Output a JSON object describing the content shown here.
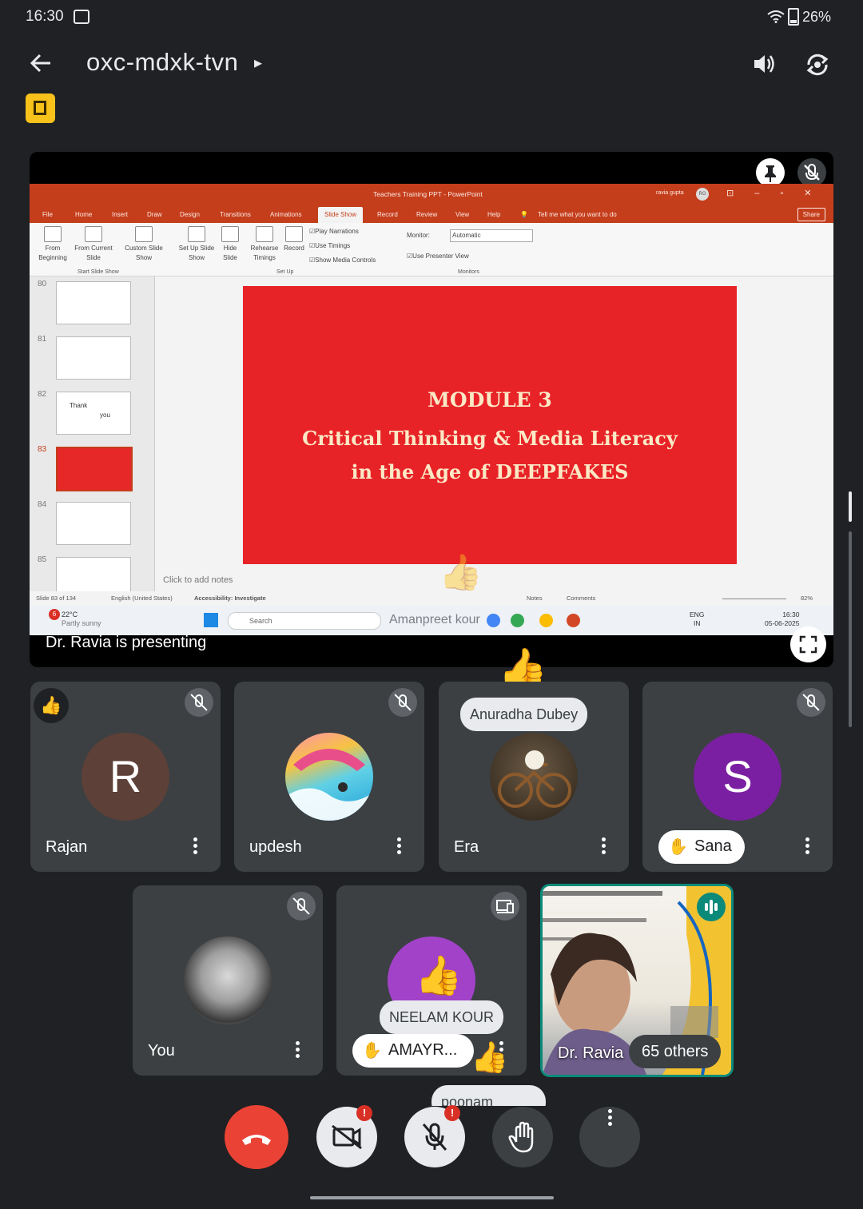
{
  "status_bar": {
    "time": "16:30",
    "battery": "26%"
  },
  "header": {
    "meeting_code": "oxc-mdxk-tvn"
  },
  "presentation": {
    "presenter_label": "Dr. Ravia is presenting",
    "overlay_name": "Amanpreet kour",
    "powerpoint": {
      "window_title": "Teachers Training PPT  -  PowerPoint",
      "user": "ravia gupta",
      "user_initials": "RG",
      "menus": [
        "File",
        "Home",
        "Insert",
        "Draw",
        "Design",
        "Transitions",
        "Animations",
        "Slide Show",
        "Record",
        "Review",
        "View",
        "Help"
      ],
      "active_menu": "Slide Show",
      "tell_me": "Tell me what you want to do",
      "share": "Share",
      "ribbon": {
        "from_beginning": "From Beginning",
        "from_current": "From Current Slide",
        "custom_show": "Custom Slide Show",
        "group_start": "Start Slide Show",
        "setup_show": "Set Up Slide Show",
        "hide_slide": "Hide Slide",
        "rehearse": "Rehearse Timings",
        "record": "Record",
        "group_setup": "Set Up",
        "play_narrations": "Play Narrations",
        "use_timings": "Use Timings",
        "show_media": "Show Media Controls",
        "monitor_label": "Monitor:",
        "monitor_value": "Automatic",
        "presenter_view": "Use Presenter View",
        "group_monitors": "Monitors"
      },
      "slide_numbers": [
        "80",
        "81",
        "82",
        "83",
        "84",
        "85"
      ],
      "thumb82_text1": "Thank",
      "thumb82_text2": "you",
      "slide": {
        "line1": "MODULE 3",
        "line2": "Critical Thinking & Media Literacy",
        "line3": "in the Age of DEEPFAKES"
      },
      "notes_placeholder": "Click to add notes",
      "status": {
        "slide_count": "Slide 83 of 134",
        "language": "English (United States)",
        "accessibility": "Accessibility: Investigate",
        "notes": "Notes",
        "comments": "Comments",
        "zoom": "82%"
      },
      "taskbar": {
        "temperature": "22°C",
        "weather": "Partly sunny",
        "weather_badge": "6",
        "search": "Search",
        "lang1": "ENG",
        "lang2": "IN",
        "time": "16:30",
        "date": "05-06-2025"
      }
    }
  },
  "participants": [
    {
      "name": "Rajan",
      "initial": "R",
      "color": "#5d4037",
      "muted": true,
      "reaction": "👍"
    },
    {
      "name": "updesh",
      "muted": true
    },
    {
      "name": "Era",
      "chip": "Anuradha Dubey",
      "reaction": "👍"
    },
    {
      "name": "Sana",
      "initial": "S",
      "color": "#7b1fa2",
      "muted": true,
      "hand_raised": true
    },
    {
      "name": "You",
      "muted": true
    },
    {
      "name": "AMAYR...",
      "chip": "NEELAM KOUR",
      "hand_raised": true,
      "reaction": "👍"
    },
    {
      "name": "Dr. Ravia",
      "others": "65 others",
      "speaking": true
    }
  ],
  "floating_chip": "poonam jamwal",
  "controls": {
    "end_call": "end-call",
    "camera_badge": "!",
    "mic_badge": "!"
  },
  "colors": {
    "background": "#1f2124",
    "tile": "#3c4043",
    "end_call": "#ea4335",
    "powerpoint_red": "#c43e1c",
    "slide_red": "#e72328",
    "speaking_ring": "#0b8a7a"
  }
}
